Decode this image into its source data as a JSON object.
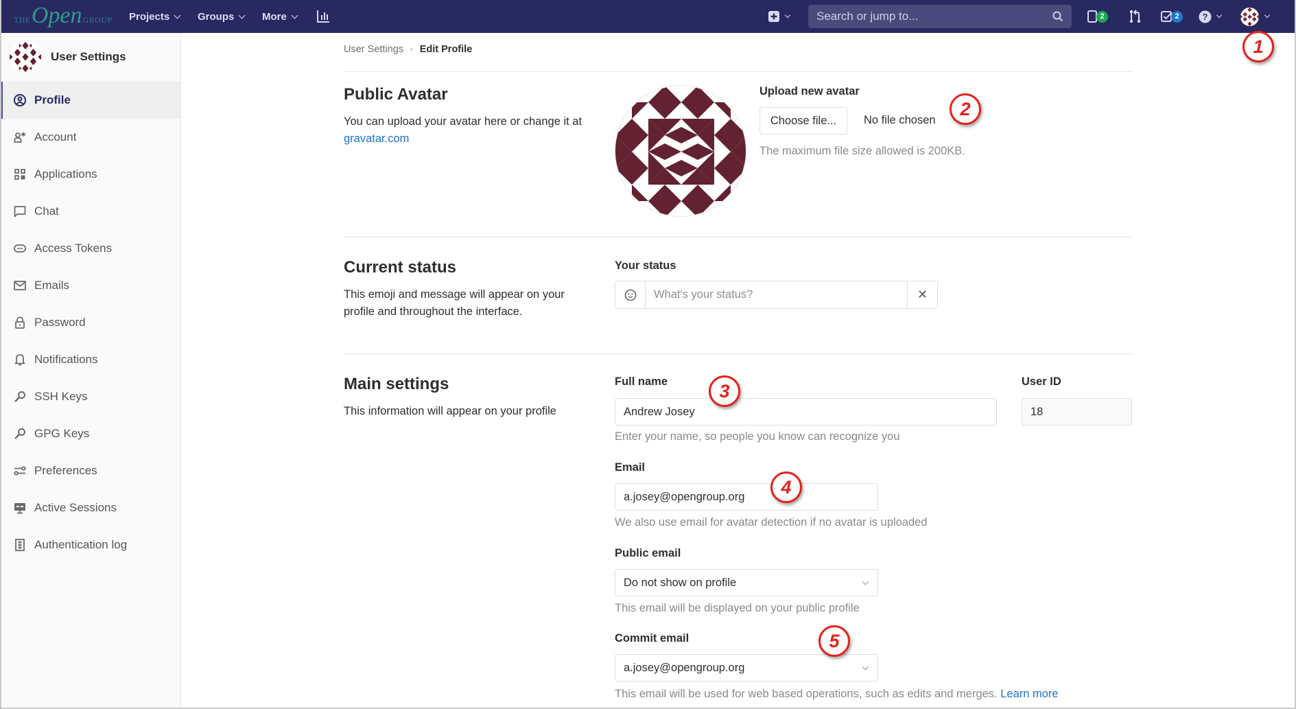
{
  "header": {
    "logo": {
      "the": "THE",
      "open": "Open",
      "group": "GROUP"
    },
    "nav": [
      {
        "label": "Projects"
      },
      {
        "label": "Groups"
      },
      {
        "label": "More"
      }
    ],
    "activity_icon": "chart-bar-icon",
    "new_icon": "plus-square-icon",
    "search_placeholder": "Search or jump to...",
    "issues_count": "2",
    "todos_count": "2",
    "colors": {
      "bar": "#292961",
      "issues_badge": "#1aaa55",
      "todos_badge": "#1f78d1"
    }
  },
  "sidebar": {
    "title": "User Settings",
    "items": [
      {
        "label": "Profile",
        "icon": "profile-icon",
        "active": true
      },
      {
        "label": "Account",
        "icon": "account-icon"
      },
      {
        "label": "Applications",
        "icon": "applications-icon"
      },
      {
        "label": "Chat",
        "icon": "chat-icon"
      },
      {
        "label": "Access Tokens",
        "icon": "token-icon"
      },
      {
        "label": "Emails",
        "icon": "envelope-icon"
      },
      {
        "label": "Password",
        "icon": "lock-icon"
      },
      {
        "label": "Notifications",
        "icon": "bell-icon"
      },
      {
        "label": "SSH Keys",
        "icon": "key-icon"
      },
      {
        "label": "GPG Keys",
        "icon": "key-icon"
      },
      {
        "label": "Preferences",
        "icon": "preferences-icon"
      },
      {
        "label": "Active Sessions",
        "icon": "monitor-icon"
      },
      {
        "label": "Authentication log",
        "icon": "log-icon"
      }
    ]
  },
  "breadcrumb": {
    "parent": "User Settings",
    "current": "Edit Profile"
  },
  "avatar_section": {
    "title": "Public Avatar",
    "description": "You can upload your avatar here or change it at",
    "link": "gravatar.com",
    "upload_label": "Upload new avatar",
    "choose_button": "Choose file...",
    "no_file": "No file chosen",
    "help": "The maximum file size allowed is 200KB."
  },
  "status_section": {
    "title": "Current status",
    "description": "This emoji and message will appear on your profile and throughout the interface.",
    "label": "Your status",
    "placeholder": "What's your status?"
  },
  "main_section": {
    "title": "Main settings",
    "description": "This information will appear on your profile",
    "full_name_label": "Full name",
    "full_name_value": "Andrew Josey",
    "full_name_help": "Enter your name, so people you know can recognize you",
    "user_id_label": "User ID",
    "user_id_value": "18",
    "email_label": "Email",
    "email_value": "a.josey@opengroup.org",
    "email_help": "We also use email for avatar detection if no avatar is uploaded",
    "public_email_label": "Public email",
    "public_email_value": "Do not show on profile",
    "public_email_help": "This email will be displayed on your public profile",
    "commit_email_label": "Commit email",
    "commit_email_value": "a.josey@opengroup.org",
    "commit_email_help": "This email will be used for web based operations, such as edits and merges.",
    "learn_more": "Learn more"
  },
  "callouts": [
    "1",
    "2",
    "3",
    "4",
    "5"
  ]
}
